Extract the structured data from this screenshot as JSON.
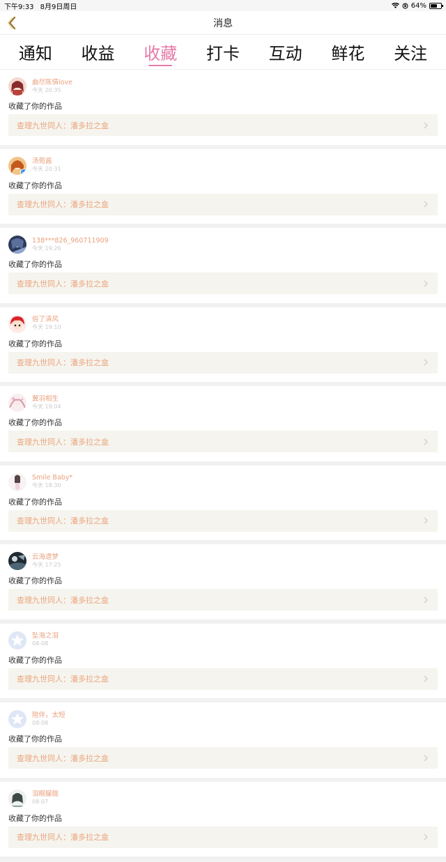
{
  "status": {
    "time": "下午9:33",
    "date": "8月9日周日",
    "battery": "64%",
    "battery_level": 0.64
  },
  "header": {
    "title": "消息"
  },
  "tabs": [
    {
      "label": "通知"
    },
    {
      "label": "收益"
    },
    {
      "label": "收藏"
    },
    {
      "label": "打卡"
    },
    {
      "label": "互动"
    },
    {
      "label": "鲜花"
    },
    {
      "label": "关注"
    }
  ],
  "active_tab": "收藏",
  "items": [
    {
      "name": "曲尽陈情love",
      "time": "今天 20:35",
      "action": "收藏了你的作品",
      "work": "查理九世同人：潘多拉之盒",
      "avatar": "avatar-red"
    },
    {
      "name": "汤菀酱",
      "time": "今天 20:31",
      "action": "收藏了你的作品",
      "work": "查理九世同人：潘多拉之盒",
      "avatar": "avatar-orange"
    },
    {
      "name": "138***826_960711909",
      "time": "今天 19:26",
      "action": "收藏了你的作品",
      "work": "查理九世同人：潘多拉之盒",
      "avatar": "avatar-blue"
    },
    {
      "name": "俗了清风",
      "time": "今天 19:10",
      "action": "收藏了你的作品",
      "work": "查理九世同人：潘多拉之盒",
      "avatar": "avatar-crimson"
    },
    {
      "name": "冀羽相生",
      "time": "今天 19:04",
      "action": "收藏了你的作品",
      "work": "查理九世同人：潘多拉之盒",
      "avatar": "avatar-pink"
    },
    {
      "name": "Smile Baby*",
      "time": "今天 18:30",
      "action": "收藏了你的作品",
      "work": "查理九世同人：潘多拉之盒",
      "avatar": "avatar-girl"
    },
    {
      "name": "云海遗梦",
      "time": "今天 17:25",
      "action": "收藏了你的作品",
      "work": "查理九世同人：潘多拉之盒",
      "avatar": "avatar-dark"
    },
    {
      "name": "坠海之泪",
      "time": "08-08",
      "action": "收藏了你的作品",
      "work": "查理九世同人：潘多拉之盒",
      "avatar": "avatar-default"
    },
    {
      "name": "陪伴，太短",
      "time": "08-08",
      "action": "收藏了你的作品",
      "work": "查理九世同人：潘多拉之盒",
      "avatar": "avatar-default"
    },
    {
      "name": "泪眼朦胧",
      "time": "08-07",
      "action": "收藏了你的作品",
      "work": "查理九世同人：潘多拉之盒",
      "avatar": "avatar-sketch"
    }
  ],
  "colors": {
    "accent": "#e57ba8",
    "username": "#e9a07d",
    "work_bg": "#f5f4ee"
  }
}
